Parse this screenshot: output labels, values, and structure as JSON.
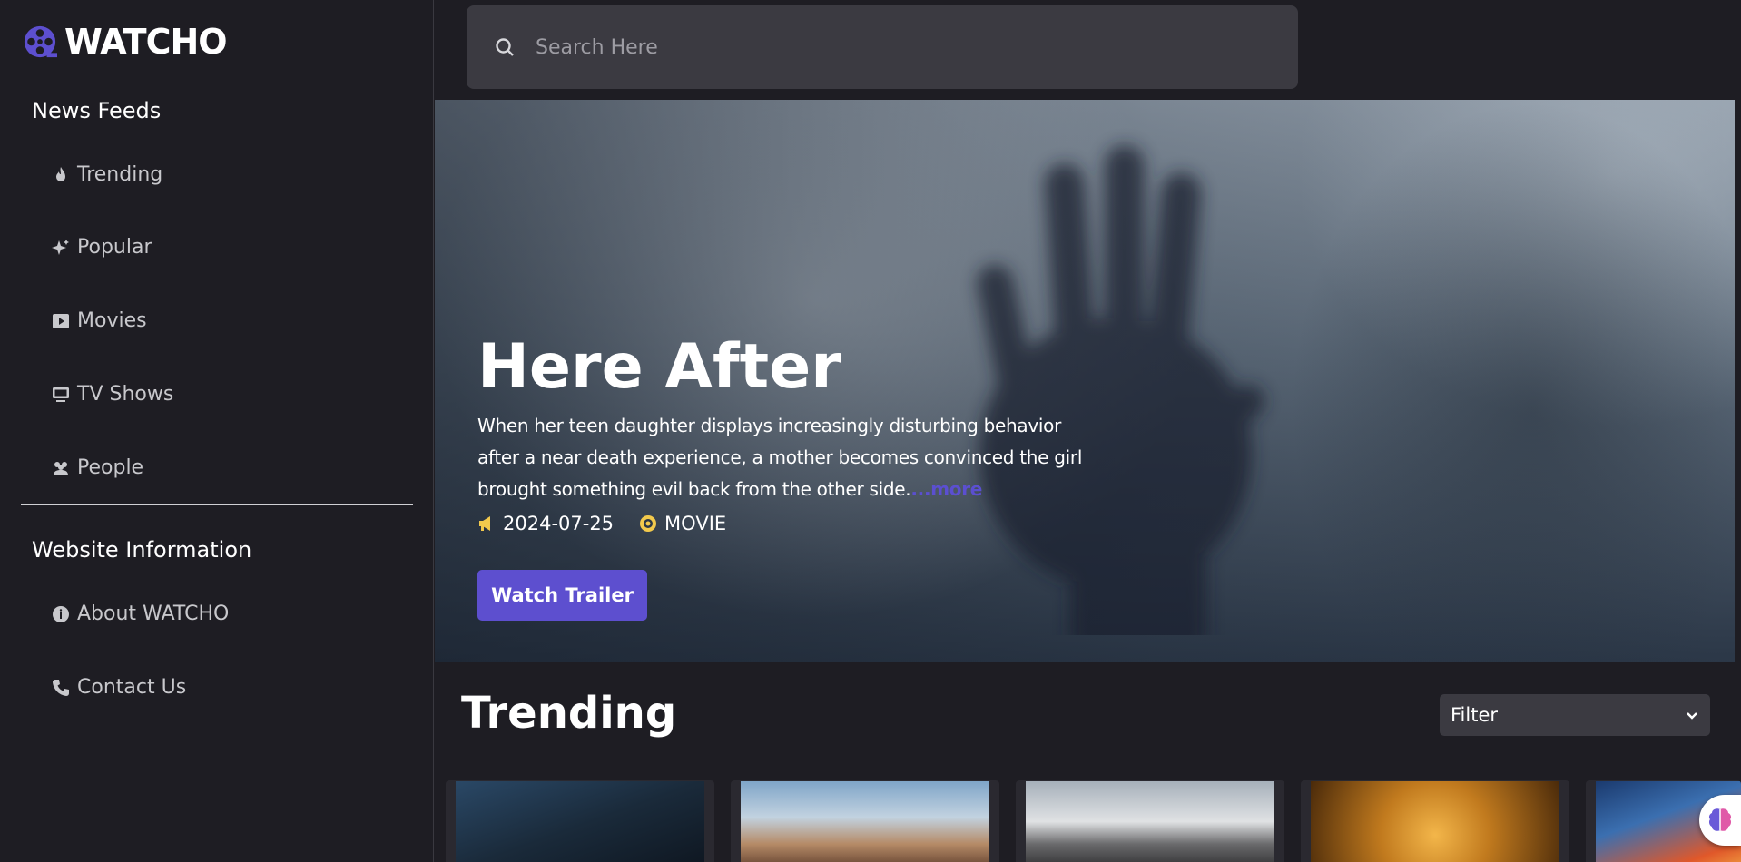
{
  "brand": {
    "name": "WATCHO"
  },
  "sidebar": {
    "news_feeds_title": "News Feeds",
    "news_items": [
      {
        "label": "Trending",
        "icon": "fire-icon"
      },
      {
        "label": "Popular",
        "icon": "sparkle-icon"
      },
      {
        "label": "Movies",
        "icon": "play-square-icon"
      },
      {
        "label": "TV Shows",
        "icon": "tv-icon"
      },
      {
        "label": "People",
        "icon": "people-icon"
      }
    ],
    "website_info_title": "Website Information",
    "info_items": [
      {
        "label": "About WATCHO",
        "icon": "info-icon"
      },
      {
        "label": "Contact Us",
        "icon": "phone-icon"
      }
    ]
  },
  "search": {
    "placeholder": "Search Here"
  },
  "hero": {
    "title": "Here After",
    "description": "When her teen daughter displays increasingly disturbing behavior after a near death experience, a mother becomes convinced the girl brought something evil back from the other side.",
    "more_label": "...more",
    "date": "2024-07-25",
    "media_type": "MOVIE",
    "trailer_label": "Watch Trailer"
  },
  "trending": {
    "title": "Trending",
    "filter_label": "Filter",
    "cards": [
      {},
      {},
      {},
      {},
      {}
    ]
  },
  "colors": {
    "accent": "#5d4fcf",
    "background": "#1e1d23",
    "panel": "#3b3a41",
    "meta_icon": "#f2c94c"
  }
}
